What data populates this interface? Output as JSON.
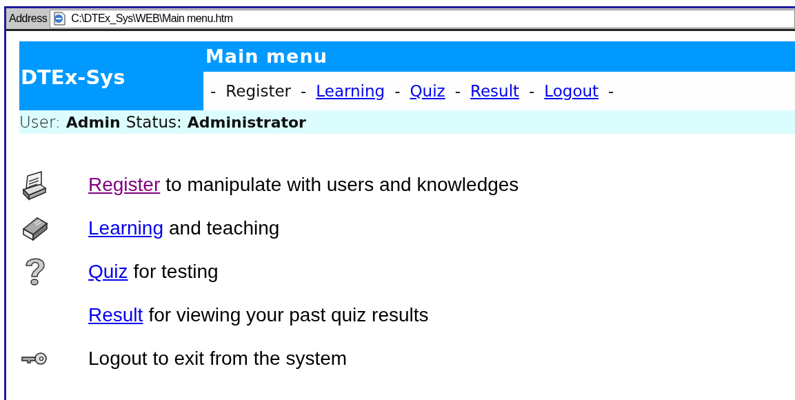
{
  "address_bar": {
    "label": "Address",
    "url": "C:\\DTEx_Sys\\WEB\\Main menu.htm"
  },
  "header": {
    "logo": "DTEx-Sys",
    "title": "Main menu",
    "nav": [
      {
        "kind": "separator",
        "label": "-"
      },
      {
        "kind": "text",
        "label": "Register"
      },
      {
        "kind": "separator",
        "label": "-"
      },
      {
        "kind": "link",
        "label": "Learning"
      },
      {
        "kind": "separator",
        "label": "-"
      },
      {
        "kind": "link",
        "label": "Quiz"
      },
      {
        "kind": "separator",
        "label": "-"
      },
      {
        "kind": "link",
        "label": "Result"
      },
      {
        "kind": "separator",
        "label": "-"
      },
      {
        "kind": "link",
        "label": "Logout"
      },
      {
        "kind": "separator",
        "label": "-"
      }
    ]
  },
  "user_bar": {
    "user_label": "User:",
    "user": "Admin",
    "status_label": "Status:",
    "status": "Administrator"
  },
  "menu": [
    {
      "link": "Register",
      "visited": true,
      "text": "to manipulate with users and knowledges"
    },
    {
      "link": "Learning",
      "visited": false,
      "text": "and teaching"
    },
    {
      "link": "Quiz",
      "visited": false,
      "text": "for testing"
    },
    {
      "link": "Result",
      "visited": false,
      "text": "for viewing your past quiz results"
    },
    {
      "text": "Logout to exit from the system"
    }
  ]
}
